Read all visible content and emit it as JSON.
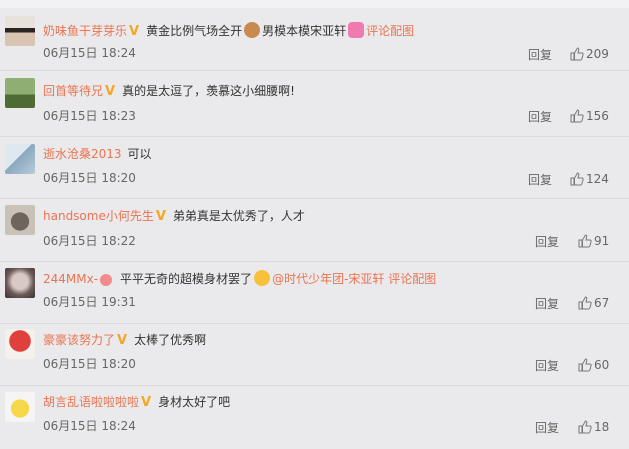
{
  "comments": [
    {
      "user": "奶味鱼干芽芽乐",
      "badge": "V",
      "text": "黄金比例气场全开",
      "text2": "男模本模宋亚轩",
      "link": "评论配图",
      "time": "06月15日 18:24",
      "reply": "回复",
      "likes": "209"
    },
    {
      "user": "回首等待兄",
      "badge": "V",
      "text": "真的是太逗了，羡慕这小细腰啊!",
      "time": "06月15日 18:23",
      "reply": "回复",
      "likes": "156"
    },
    {
      "user": "逝水沧桑2013",
      "text": "可以",
      "time": "06月15日 18:20",
      "reply": "回复",
      "likes": "124"
    },
    {
      "user": "handsome小何先生",
      "badge": "V",
      "text": "弟弟真是太优秀了，人才",
      "time": "06月15日 18:22",
      "reply": "回复",
      "likes": "91"
    },
    {
      "user": "244MMx-",
      "text": "平平无奇的超模身材罢了",
      "mention": "@时代少年团-宋亚轩",
      "link": "评论配图",
      "time": "06月15日 19:31",
      "reply": "回复",
      "likes": "67"
    },
    {
      "user": "豪豪该努力了",
      "badge": "V",
      "text": "太棒了优秀啊",
      "time": "06月15日 18:20",
      "reply": "回复",
      "likes": "60"
    },
    {
      "user": "胡言乱语啦啦啦啦",
      "badge": "V",
      "text": "身材太好了吧",
      "time": "06月15日 18:24",
      "reply": "回复",
      "likes": "18"
    }
  ],
  "colors": {
    "username": "#eb7350",
    "badge": "#f5a623",
    "background": "#eaeaec"
  }
}
